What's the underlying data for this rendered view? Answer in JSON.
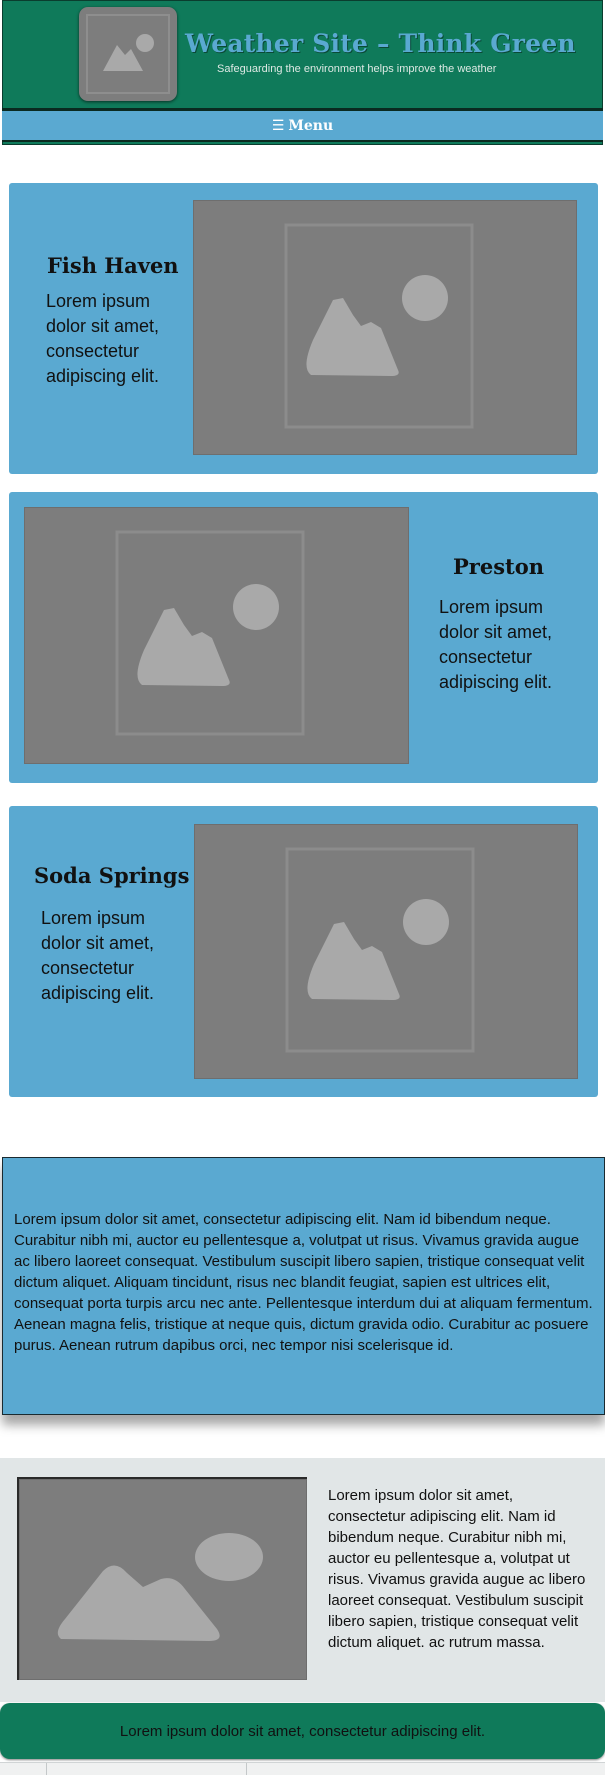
{
  "header": {
    "title": "Weather Site – Think Green",
    "tagline": "Safeguarding the environment helps improve the weather",
    "logo_icon": "image-placeholder-icon"
  },
  "nav": {
    "menu_icon": "☰",
    "menu_label": "Menu"
  },
  "towns": [
    {
      "name": "Fish Haven",
      "text": "Lorem ipsum dolor sit amet, consectetur adipiscing elit."
    },
    {
      "name": "Preston",
      "text": "Lorem ipsum dolor sit amet, consectetur adipiscing elit."
    },
    {
      "name": "Soda Springs",
      "text": "Lorem ipsum dolor sit amet, consectetur adipiscing elit."
    }
  ],
  "about": {
    "text": "Lorem ipsum dolor sit amet, consectetur adipiscing elit. Nam id bibendum neque. Curabitur nibh mi, auctor eu pellentesque a, volutpat ut risus. Vivamus gravida augue ac libero laoreet consequat. Vestibulum suscipit libero sapien, tristique consequat velit dictum aliquet. Aliquam tincidunt, risus nec blandit feugiat, sapien est ultrices elit, consequat porta turpis arcu nec ante. Pellentesque interdum dui at aliquam fermentum. Aenean magna felis, tristique at neque quis, dictum gravida odio. Curabitur ac posuere purus. Aenean rutrum dapibus orci, nec tempor nisi scelerisque id."
  },
  "feature": {
    "text": "Lorem ipsum dolor sit amet, consectetur adipiscing elit. Nam id bibendum neque. Curabitur nibh mi, auctor eu pellentesque a, volutpat ut risus. Vivamus gravida augue ac libero laoreet consequat. Vestibulum suscipit libero sapien, tristique consequat velit dictum aliquet. ac rutrum massa."
  },
  "footer": {
    "text": "Lorem ipsum dolor sit amet, consectetur adipiscing elit."
  },
  "colors": {
    "header_bg": "#0f7a5a",
    "accent_blue": "#5aa9d1",
    "placeholder_gray": "#7d7d7d"
  }
}
